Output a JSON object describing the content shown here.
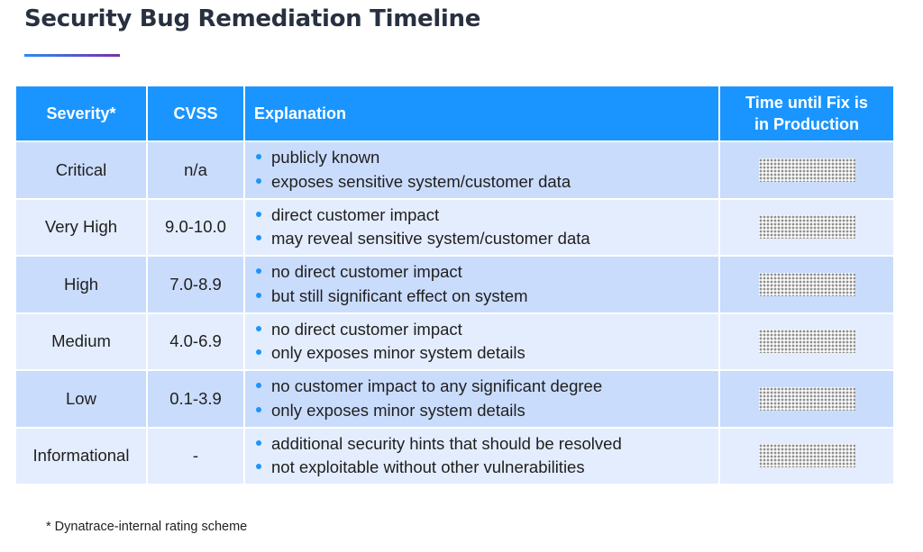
{
  "page": {
    "title": "Security Bug Remediation Timeline",
    "accent_gradient": [
      "#2a8cf3",
      "#7a2fa5"
    ],
    "header_color": "#1a95ff",
    "row_colors": [
      "#cadcfc",
      "#e4edfd"
    ]
  },
  "table": {
    "headers": {
      "severity": "Severity*",
      "cvss": "CVSS",
      "explanation": "Explanation",
      "time_line1": "Time until Fix is",
      "time_line2": "in Production"
    },
    "rows": [
      {
        "severity": "Critical",
        "cvss": "n/a",
        "explanation": [
          "publicly known",
          "exposes sensitive system/customer data"
        ],
        "time": "redacted"
      },
      {
        "severity": "Very High",
        "cvss": "9.0-10.0",
        "explanation": [
          "direct customer impact",
          "may reveal sensitive system/customer data"
        ],
        "time": "redacted"
      },
      {
        "severity": "High",
        "cvss": "7.0-8.9",
        "explanation": [
          "no direct customer impact",
          "but still significant effect on system"
        ],
        "time": "redacted"
      },
      {
        "severity": "Medium",
        "cvss": "4.0-6.9",
        "explanation": [
          "no direct customer impact",
          "only exposes minor system details"
        ],
        "time": "redacted"
      },
      {
        "severity": "Low",
        "cvss": "0.1-3.9",
        "explanation": [
          "no customer impact to any significant degree",
          "only exposes minor system details"
        ],
        "time": "redacted"
      },
      {
        "severity": "Informational",
        "cvss": "-",
        "explanation": [
          "additional security hints that should be resolved",
          "not exploitable without other vulnerabilities"
        ],
        "time": "redacted"
      }
    ]
  },
  "footnote": "* Dynatrace-internal rating scheme"
}
